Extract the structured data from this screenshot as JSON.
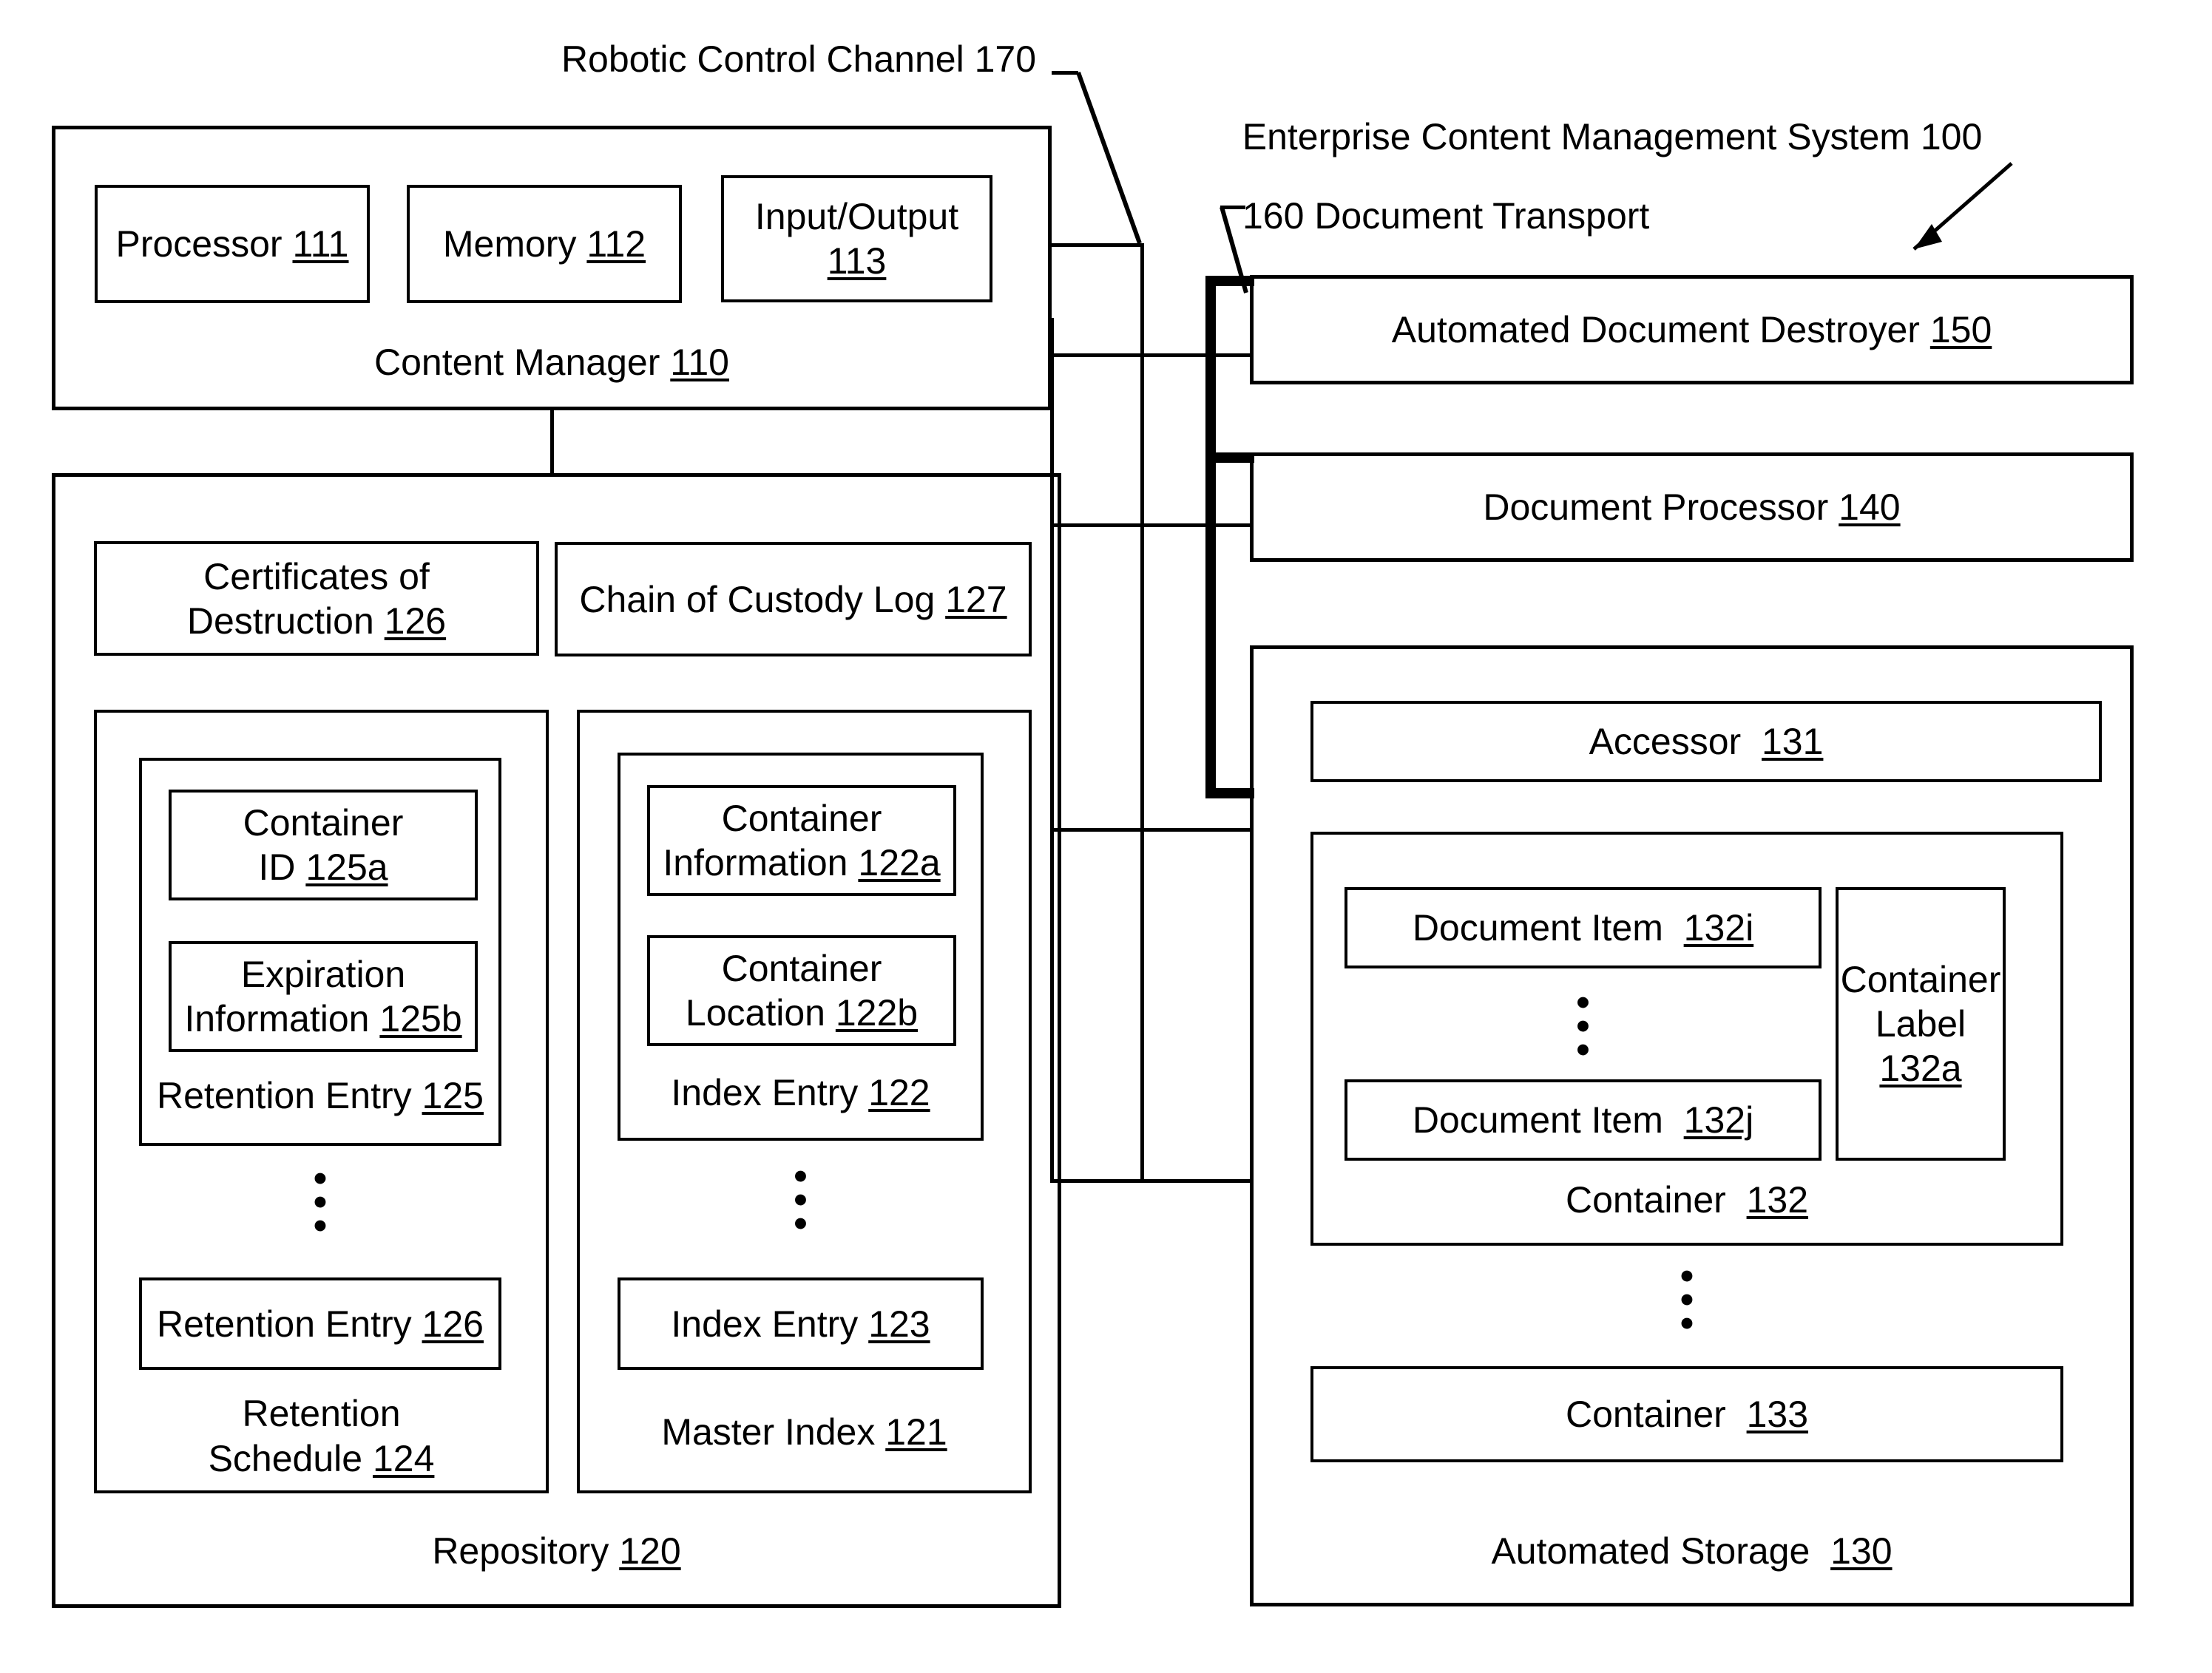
{
  "figure": {
    "title": "Enterprise Content Management System 100",
    "annotations": {
      "robotic_control_channel": "Robotic Control Channel 170",
      "document_transport": "160 Document Transport"
    }
  },
  "content_manager": {
    "label": "Content Manager",
    "ref": "110",
    "children": [
      {
        "label": "Processor",
        "ref": "111"
      },
      {
        "label": "Memory",
        "ref": "112"
      },
      {
        "label": "Input/Output",
        "ref": "113"
      }
    ]
  },
  "repository": {
    "label": "Repository",
    "ref": "120",
    "certificates_of_destruction": {
      "line1": "Certificates of",
      "line2": "Destruction",
      "ref": "126"
    },
    "chain_of_custody_log": {
      "label": "Chain of Custody Log",
      "ref": "127"
    },
    "retention_schedule": {
      "line1": "Retention",
      "line2": "Schedule",
      "ref": "124",
      "entry_first": {
        "label": "Retention Entry",
        "ref": "125",
        "fields": [
          {
            "line1": "Container",
            "line2": "ID",
            "ref": "125a"
          },
          {
            "line1": "Expiration",
            "line2": "Information",
            "ref": "125b"
          }
        ]
      },
      "ellipsis": "•\n•\n•",
      "entry_last": {
        "label": "Retention Entry",
        "ref": "126"
      }
    },
    "master_index": {
      "label": "Master Index",
      "ref": "121",
      "entry_first": {
        "label": "Index Entry",
        "ref": "122",
        "fields": [
          {
            "line1": "Container",
            "line2": "Information",
            "ref": "122a"
          },
          {
            "line1": "Container",
            "line2": "Location",
            "ref": "122b"
          }
        ]
      },
      "ellipsis": "•\n•\n•",
      "entry_last": {
        "label": "Index Entry",
        "ref": "123"
      }
    }
  },
  "automated_document_destroyer": {
    "label": "Automated Document Destroyer",
    "ref": "150"
  },
  "document_processor": {
    "label": "Document Processor",
    "ref": "140"
  },
  "automated_storage": {
    "label": "Automated Storage",
    "ref": "130",
    "accessor": {
      "label": "Accessor",
      "ref": "131"
    },
    "container_first": {
      "label": "Container",
      "ref": "132",
      "document_item_first": {
        "label": "Document Item",
        "ref": "132i"
      },
      "ellipsis": "•\n•\n•",
      "document_item_last": {
        "label": "Document Item",
        "ref": "132j"
      },
      "container_label": {
        "line1": "Container",
        "line2": "Label",
        "ref": "132a"
      }
    },
    "ellipsis": "•\n•\n•",
    "container_last": {
      "label": "Container",
      "ref": "133"
    }
  }
}
